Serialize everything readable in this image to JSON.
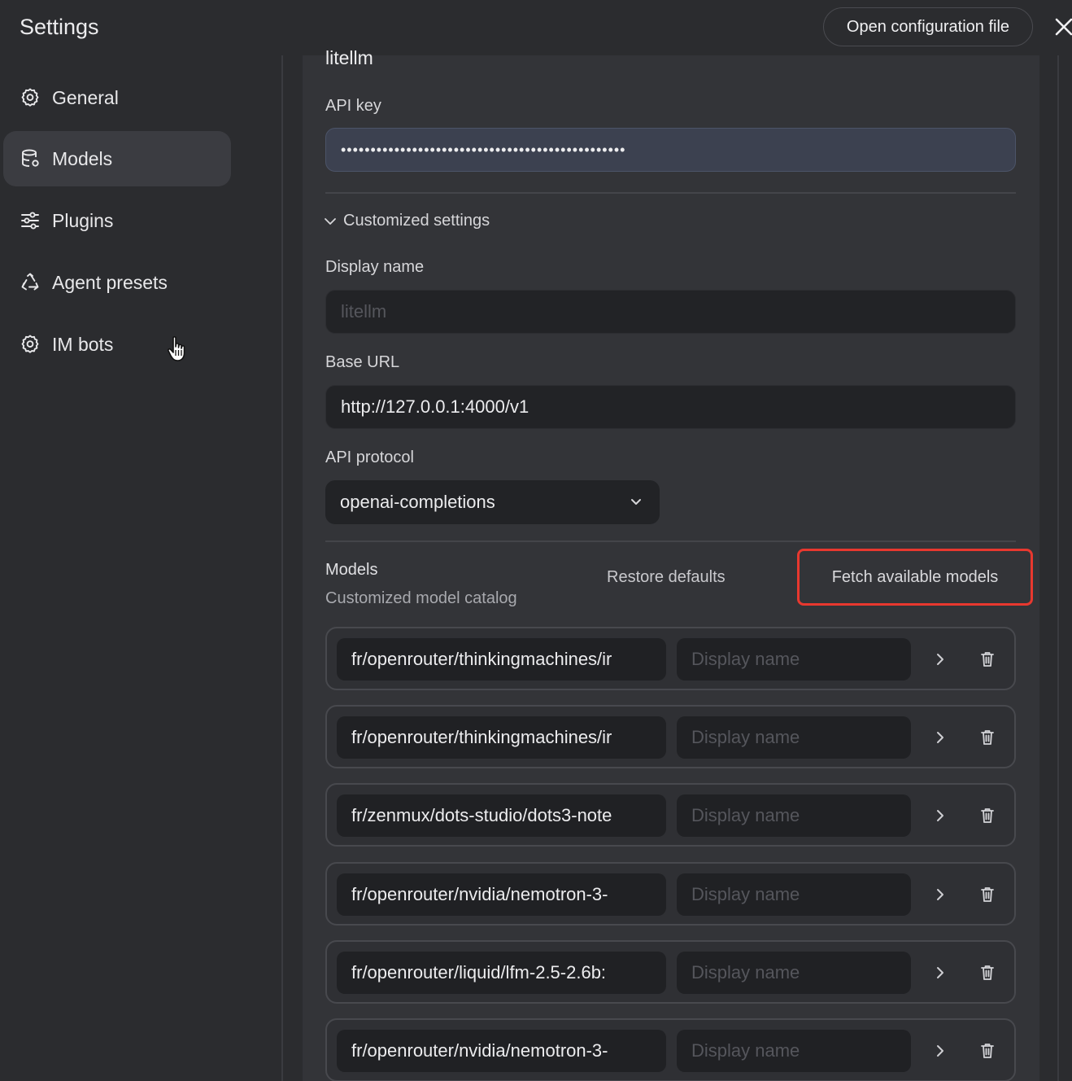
{
  "window": {
    "title": "Settings",
    "open_config_label": "Open configuration file"
  },
  "sidebar": {
    "items": [
      {
        "label": "General",
        "icon": "gear-icon"
      },
      {
        "label": "Models",
        "icon": "database-icon",
        "active": true
      },
      {
        "label": "Plugins",
        "icon": "sliders-icon"
      },
      {
        "label": "Agent presets",
        "icon": "recycle-icon"
      },
      {
        "label": "IM bots",
        "icon": "gear-icon"
      }
    ]
  },
  "provider": {
    "name": "litellm",
    "api_key_label": "API key",
    "api_key_value": "••••••••••••••••••••••••••••••••••••••••••••••••",
    "customized_settings_label": "Customized settings",
    "display_name_label": "Display name",
    "display_name_placeholder": "litellm",
    "base_url_label": "Base URL",
    "base_url_value": "http://127.0.0.1:4000/v1",
    "api_protocol_label": "API protocol",
    "api_protocol_value": "openai-completions"
  },
  "models": {
    "title": "Models",
    "subtitle": "Customized model catalog",
    "restore_label": "Restore defaults",
    "fetch_label": "Fetch available models",
    "display_placeholder": "Display name",
    "rows": [
      {
        "id": "fr/openrouter/thinkingmachines/ir"
      },
      {
        "id": "fr/openrouter/thinkingmachines/ir"
      },
      {
        "id": "fr/zenmux/dots-studio/dots3-note"
      },
      {
        "id": "fr/openrouter/nvidia/nemotron-3-"
      },
      {
        "id": "fr/openrouter/liquid/lfm-2.5-2.6b:"
      },
      {
        "id": "fr/openrouter/nvidia/nemotron-3-"
      }
    ]
  },
  "colors": {
    "background": "#2b2c2f",
    "panel": "#333438",
    "highlight": "#e8382f",
    "active_nav": "#3b3c41"
  }
}
